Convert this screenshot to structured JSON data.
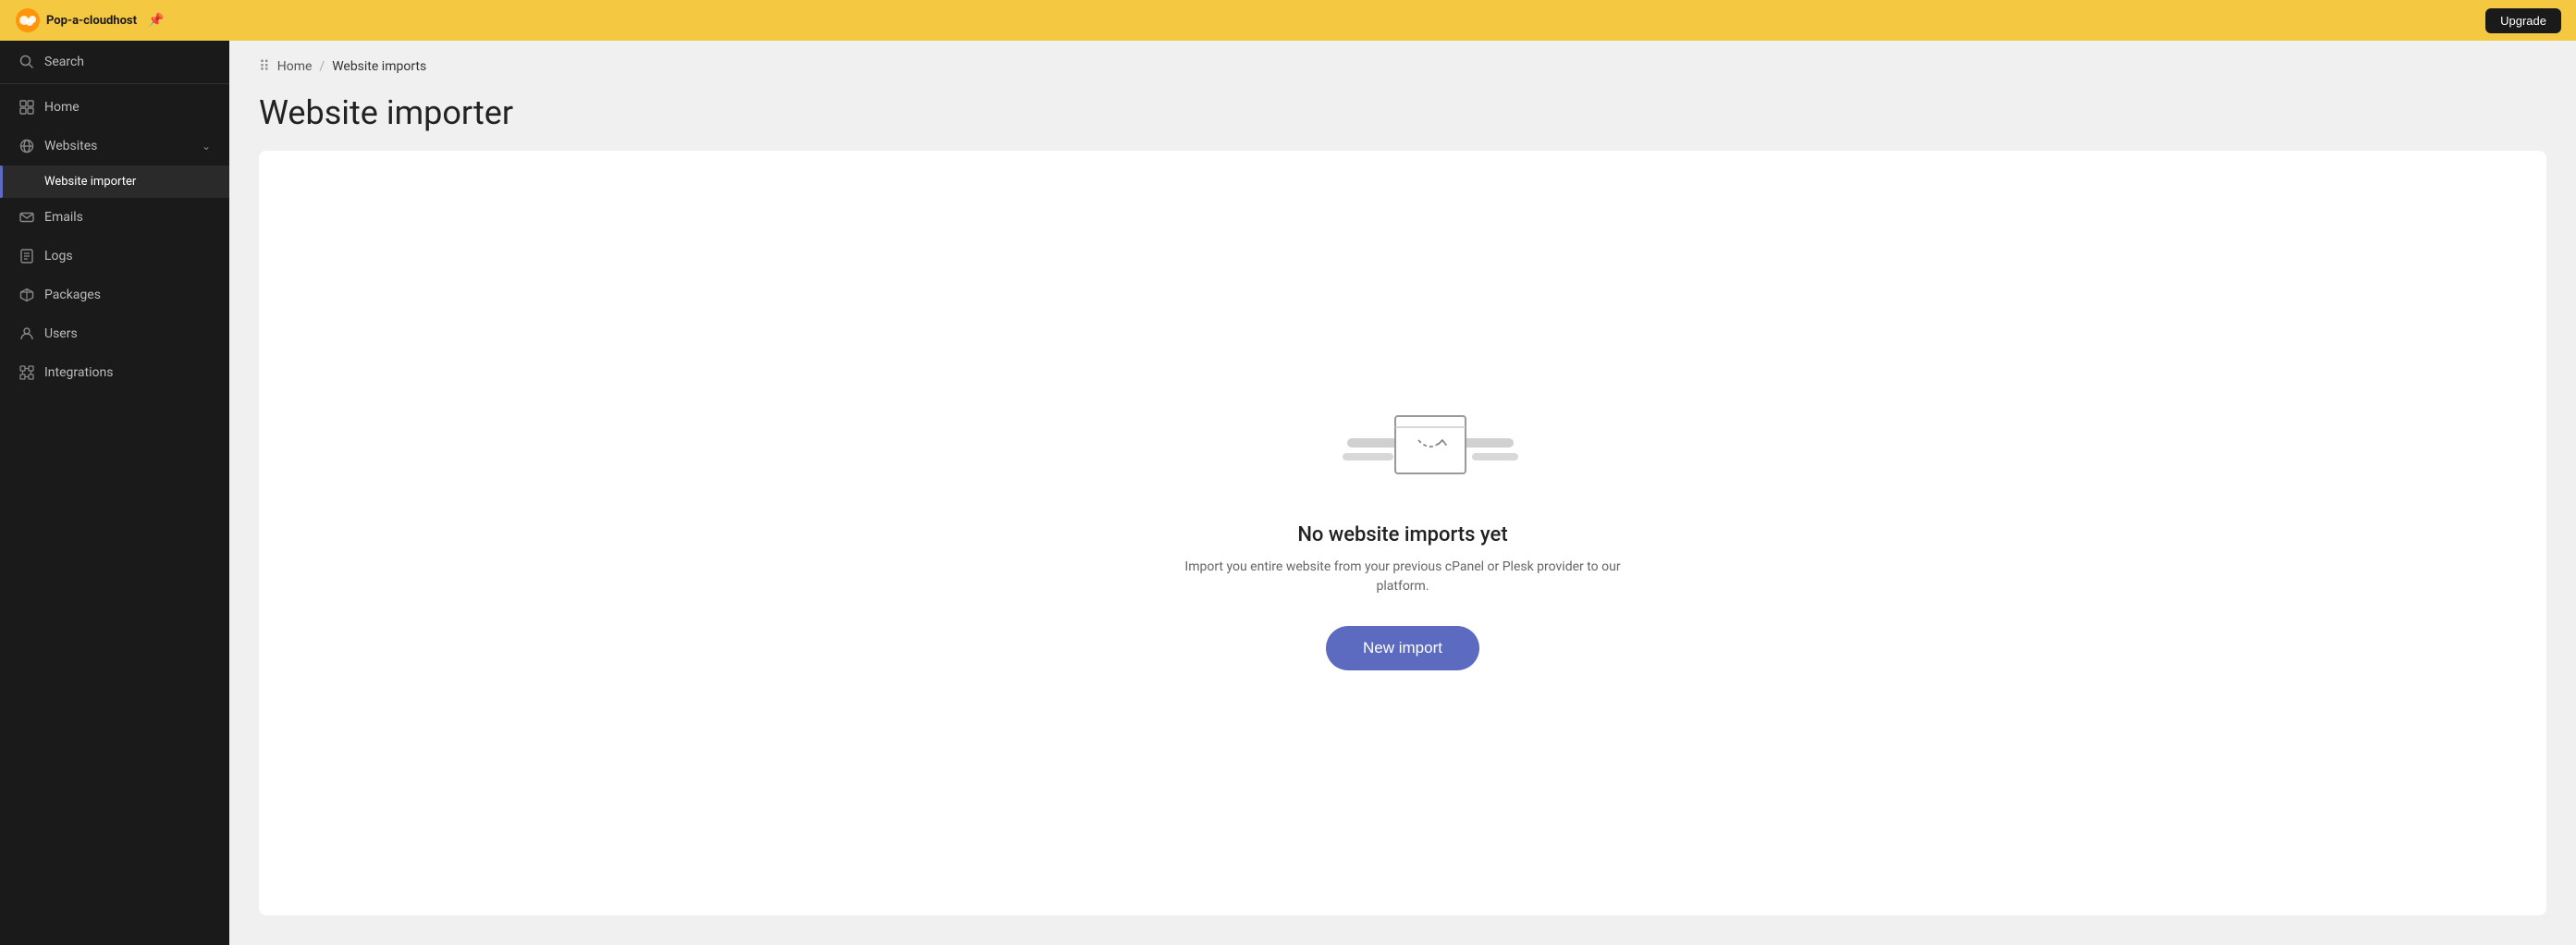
{
  "topbar": {
    "logo_text": "Pop-a-cloudhost",
    "button_label": "Upgrade"
  },
  "sidebar": {
    "search_label": "Search",
    "items": [
      {
        "id": "home",
        "label": "Home",
        "icon": "grid-icon"
      },
      {
        "id": "websites",
        "label": "Websites",
        "icon": "websites-icon",
        "has_chevron": true,
        "expanded": true
      },
      {
        "id": "website-importer",
        "label": "Website importer",
        "icon": null,
        "active": true,
        "sub": true
      },
      {
        "id": "emails",
        "label": "Emails",
        "icon": "email-icon"
      },
      {
        "id": "logs",
        "label": "Logs",
        "icon": "logs-icon"
      },
      {
        "id": "packages",
        "label": "Packages",
        "icon": "packages-icon"
      },
      {
        "id": "users",
        "label": "Users",
        "icon": "users-icon"
      },
      {
        "id": "integrations",
        "label": "Integrations",
        "icon": "integrations-icon"
      }
    ]
  },
  "breadcrumb": {
    "home_label": "Home",
    "separator": "/",
    "current_label": "Website imports"
  },
  "page": {
    "title": "Website importer"
  },
  "empty_state": {
    "title": "No website imports yet",
    "description": "Import you entire website from your previous cPanel or Plesk provider to our platform.",
    "button_label": "New import"
  }
}
